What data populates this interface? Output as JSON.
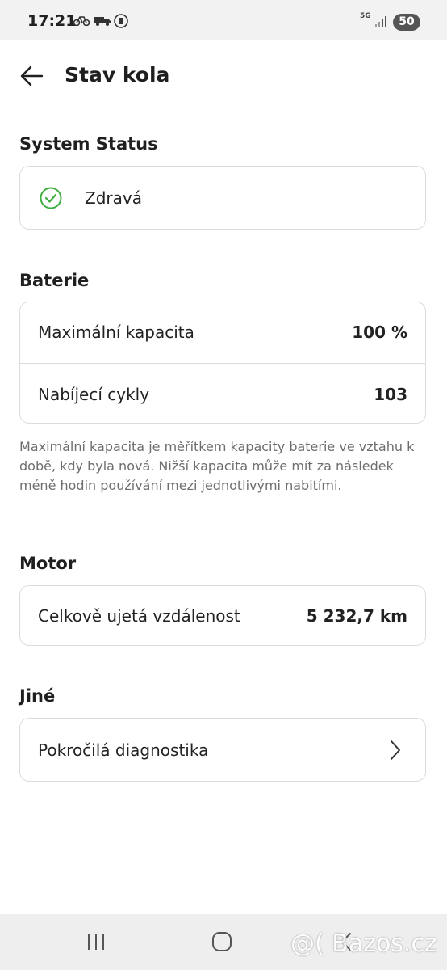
{
  "status_bar": {
    "time": "17:21",
    "network": "5G",
    "battery": "50"
  },
  "header": {
    "title": "Stav kola"
  },
  "system_status": {
    "title": "System Status",
    "status_label": "Zdravá",
    "status_color": "#3fae3f"
  },
  "battery": {
    "title": "Baterie",
    "rows": [
      {
        "label": "Maximální kapacita",
        "value": "100 %"
      },
      {
        "label": "Nabíjecí cykly",
        "value": "103"
      }
    ],
    "note": "Maximální kapacita je měřítkem kapacity baterie ve vztahu k době, kdy byla nová. Nižší kapacita může mít za následek méně hodin používání mezi jednotlivými nabitími."
  },
  "motor": {
    "title": "Motor",
    "rows": [
      {
        "label": "Celkově ujetá vzdálenost",
        "value": "5 232,7 km"
      }
    ]
  },
  "other": {
    "title": "Jiné",
    "items": [
      {
        "label": "Pokročilá diagnostika"
      }
    ]
  },
  "watermark": "@( Bazos.cz"
}
